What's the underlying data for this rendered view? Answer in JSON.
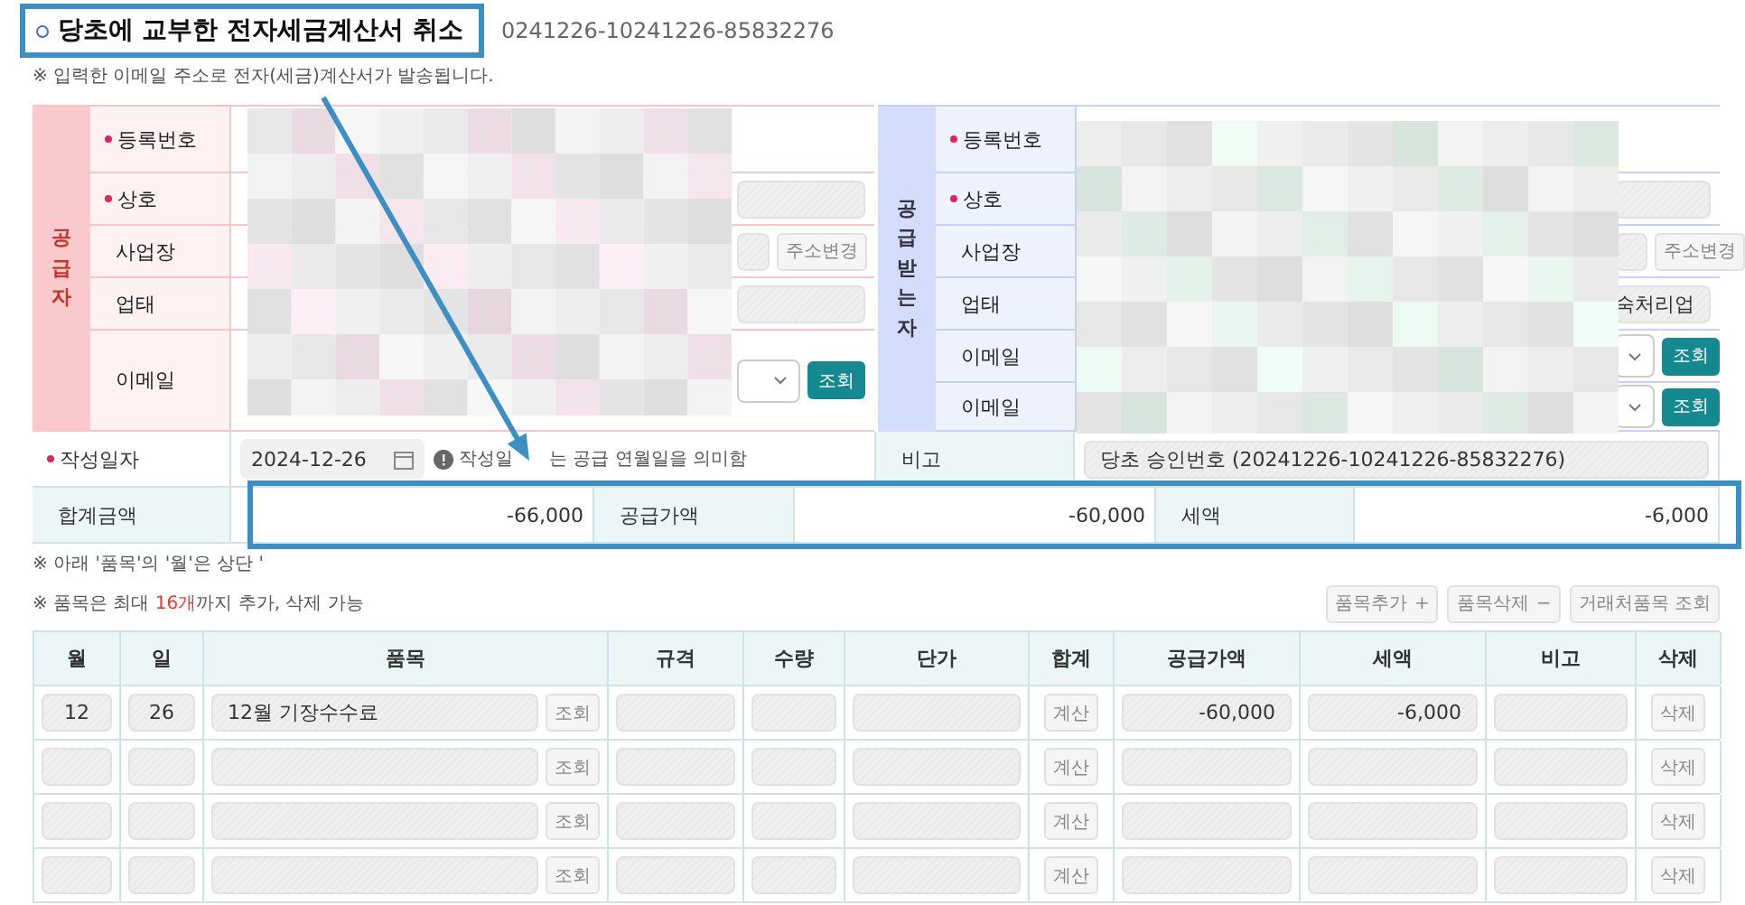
{
  "header": {
    "title": "당초에 교부한 전자세금계산서 취소",
    "number_fragment": "0241226-10241226-85832276",
    "notice": "※ 입력한 이메일 주소로 전자(세금)계산서가 발송됩니다."
  },
  "supplier": {
    "heading": "공급자",
    "fields": [
      {
        "label": "등록번호",
        "required": true,
        "kind": "plain"
      },
      {
        "label": "상호",
        "required": true,
        "kind": "input"
      },
      {
        "label": "사업장",
        "required": false,
        "kind": "address",
        "button": "주소변경"
      },
      {
        "label": "업태",
        "required": false,
        "kind": "input"
      },
      {
        "label": "이메일",
        "required": false,
        "kind": "email",
        "button": "조회"
      }
    ]
  },
  "buyer": {
    "heading": "공급받는자",
    "fields": [
      {
        "label": "등록번호",
        "required": true,
        "kind": "plain"
      },
      {
        "label": "상호",
        "required": true,
        "kind": "input"
      },
      {
        "label": "사업장",
        "required": false,
        "kind": "address",
        "button": "주소변경"
      },
      {
        "label": "업태",
        "required": false,
        "kind": "input",
        "value": "숙처리업"
      },
      {
        "label": "이메일",
        "required": false,
        "kind": "email",
        "button": "조회"
      },
      {
        "label": "이메일",
        "required": false,
        "kind": "email",
        "button": "조회"
      }
    ]
  },
  "issue_date": {
    "label": "작성일자",
    "required": true,
    "value": "2024-12-26",
    "hint": [
      "작성일",
      "는 공급 연월일을 의미함"
    ]
  },
  "remarks": {
    "label": "비고",
    "value": "당초 승인번호 (20241226-10241226-85832276)"
  },
  "totals": [
    {
      "label": "합계금액",
      "value": "-66,000"
    },
    {
      "label": "공급가액",
      "value": "-60,000"
    },
    {
      "label": "세액",
      "value": "-6,000"
    }
  ],
  "notes": [
    {
      "before": "※ 아래 '품목'의 '월'은 상단 '"
    },
    {
      "before": "※ 품목은 최대 ",
      "highlight": "16개",
      "after": "까지 추가, 삭제 가능"
    }
  ],
  "item_buttons": [
    {
      "label": "품목추가",
      "symbol": "+"
    },
    {
      "label": "품목삭제",
      "symbol": "−"
    },
    {
      "label": "거래처품목 조회"
    }
  ],
  "items": {
    "columns": [
      "월",
      "일",
      "품목",
      "규격",
      "수량",
      "단가",
      "합계",
      "공급가액",
      "세액",
      "비고",
      "삭제"
    ],
    "rows": [
      {
        "month": "12",
        "day": "26",
        "item": "12월 기장수수료",
        "lookup": "조회",
        "calc": "계산",
        "supply": "-60,000",
        "tax": "-6,000",
        "delete": "삭제"
      },
      {
        "lookup": "조회",
        "calc": "계산",
        "delete": "삭제"
      },
      {
        "lookup": "조회",
        "calc": "계산",
        "delete": "삭제"
      },
      {
        "lookup": "조회",
        "calc": "계산",
        "delete": "삭제"
      }
    ]
  }
}
